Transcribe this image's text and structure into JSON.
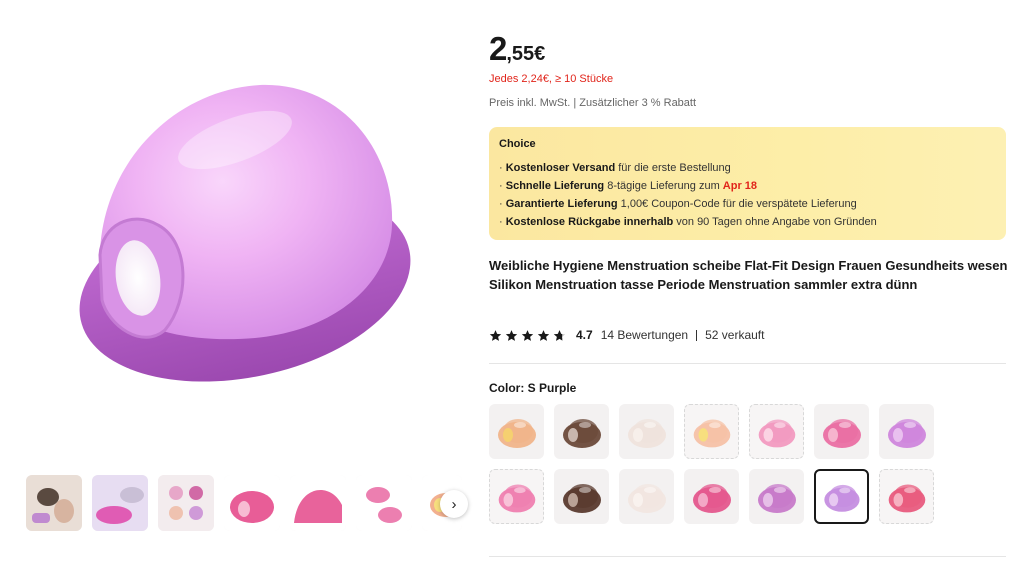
{
  "price": {
    "integer": "2",
    "decimal": ",55€"
  },
  "bulk_price": "Jedes 2,24€, ≥ 10 Stücke",
  "price_note": "Preis inkl. MwSt. | Zusätzlicher 3 % Rabatt",
  "choice": {
    "title": "Choice",
    "lines": [
      {
        "bold": "Kostenloser Versand",
        "text": " für die erste Bestellung",
        "highlight": ""
      },
      {
        "bold": "Schnelle Lieferung",
        "text": " 8-tägige Lieferung zum ",
        "highlight": "Apr 18"
      },
      {
        "bold": "Garantierte Lieferung",
        "text": "  1,00€ Coupon-Code für die verspätete Lieferung",
        "highlight": ""
      },
      {
        "bold": "Kostenlose Rückgabe innerhalb",
        "text": "  von 90 Tagen ohne Angabe von Gründen",
        "highlight": ""
      }
    ]
  },
  "product_title": "Weibliche Hygiene Menstruation scheibe Flat-Fit Design Frauen Gesundheits wesen Silikon Menstruation tasse Periode Menstruation sammler extra dünn",
  "rating": {
    "score": "4.7",
    "reviews": "14 Bewertungen",
    "sold": "52 verkauft",
    "stars": 4.7
  },
  "color": {
    "label": "Color: S Purple"
  },
  "swatches": [
    {
      "color": "#f0b48a",
      "accent": "#f5d070",
      "selected": false,
      "dashed": false
    },
    {
      "color": "#6b4a3a",
      "accent": "#c9b7ae",
      "selected": false,
      "dashed": false
    },
    {
      "color": "#efe3dc",
      "accent": "#f7efea",
      "selected": false,
      "dashed": false
    },
    {
      "color": "#f6c1a6",
      "accent": "#f7df7e",
      "selected": false,
      "dashed": true
    },
    {
      "color": "#f29ac0",
      "accent": "#fbd3e3",
      "selected": false,
      "dashed": true
    },
    {
      "color": "#ea6fa3",
      "accent": "#f6b4cd",
      "selected": false,
      "dashed": false
    },
    {
      "color": "#cf86dc",
      "accent": "#e9c0ef",
      "selected": false,
      "dashed": false
    },
    {
      "color": "#ef7fb0",
      "accent": "#f8c2d8",
      "selected": false,
      "dashed": true
    },
    {
      "color": "#5a3a2e",
      "accent": "#b9a296",
      "selected": false,
      "dashed": false
    },
    {
      "color": "#f1e6e0",
      "accent": "#f9f2ee",
      "selected": false,
      "dashed": false
    },
    {
      "color": "#e4578d",
      "accent": "#f3a8c6",
      "selected": false,
      "dashed": false
    },
    {
      "color": "#c77ac9",
      "accent": "#e6bfe7",
      "selected": false,
      "dashed": false
    },
    {
      "color": "#c58ee0",
      "accent": "#e7c8f1",
      "selected": true,
      "dashed": false
    },
    {
      "color": "#e85b7e",
      "accent": "#f6b1c1",
      "selected": false,
      "dashed": true
    }
  ],
  "thumbnails": [
    {
      "name": "thumb-1",
      "color": "#d7b4a0"
    },
    {
      "name": "thumb-2",
      "color": "#e05cb4"
    },
    {
      "name": "thumb-3",
      "color": "#e7a7c9"
    },
    {
      "name": "thumb-4",
      "color": "#e85d97"
    },
    {
      "name": "thumb-5",
      "color": "#e8639b"
    },
    {
      "name": "thumb-6",
      "color": "#ec7fb0"
    },
    {
      "name": "thumb-7",
      "color": "#f2b08f"
    }
  ],
  "icons": {
    "star": "star-icon",
    "next": "chevron-right-icon"
  },
  "colors": {
    "accent_red": "#e1251b",
    "choice_bg": "#fdeea8",
    "main_product": "#d68de6"
  }
}
